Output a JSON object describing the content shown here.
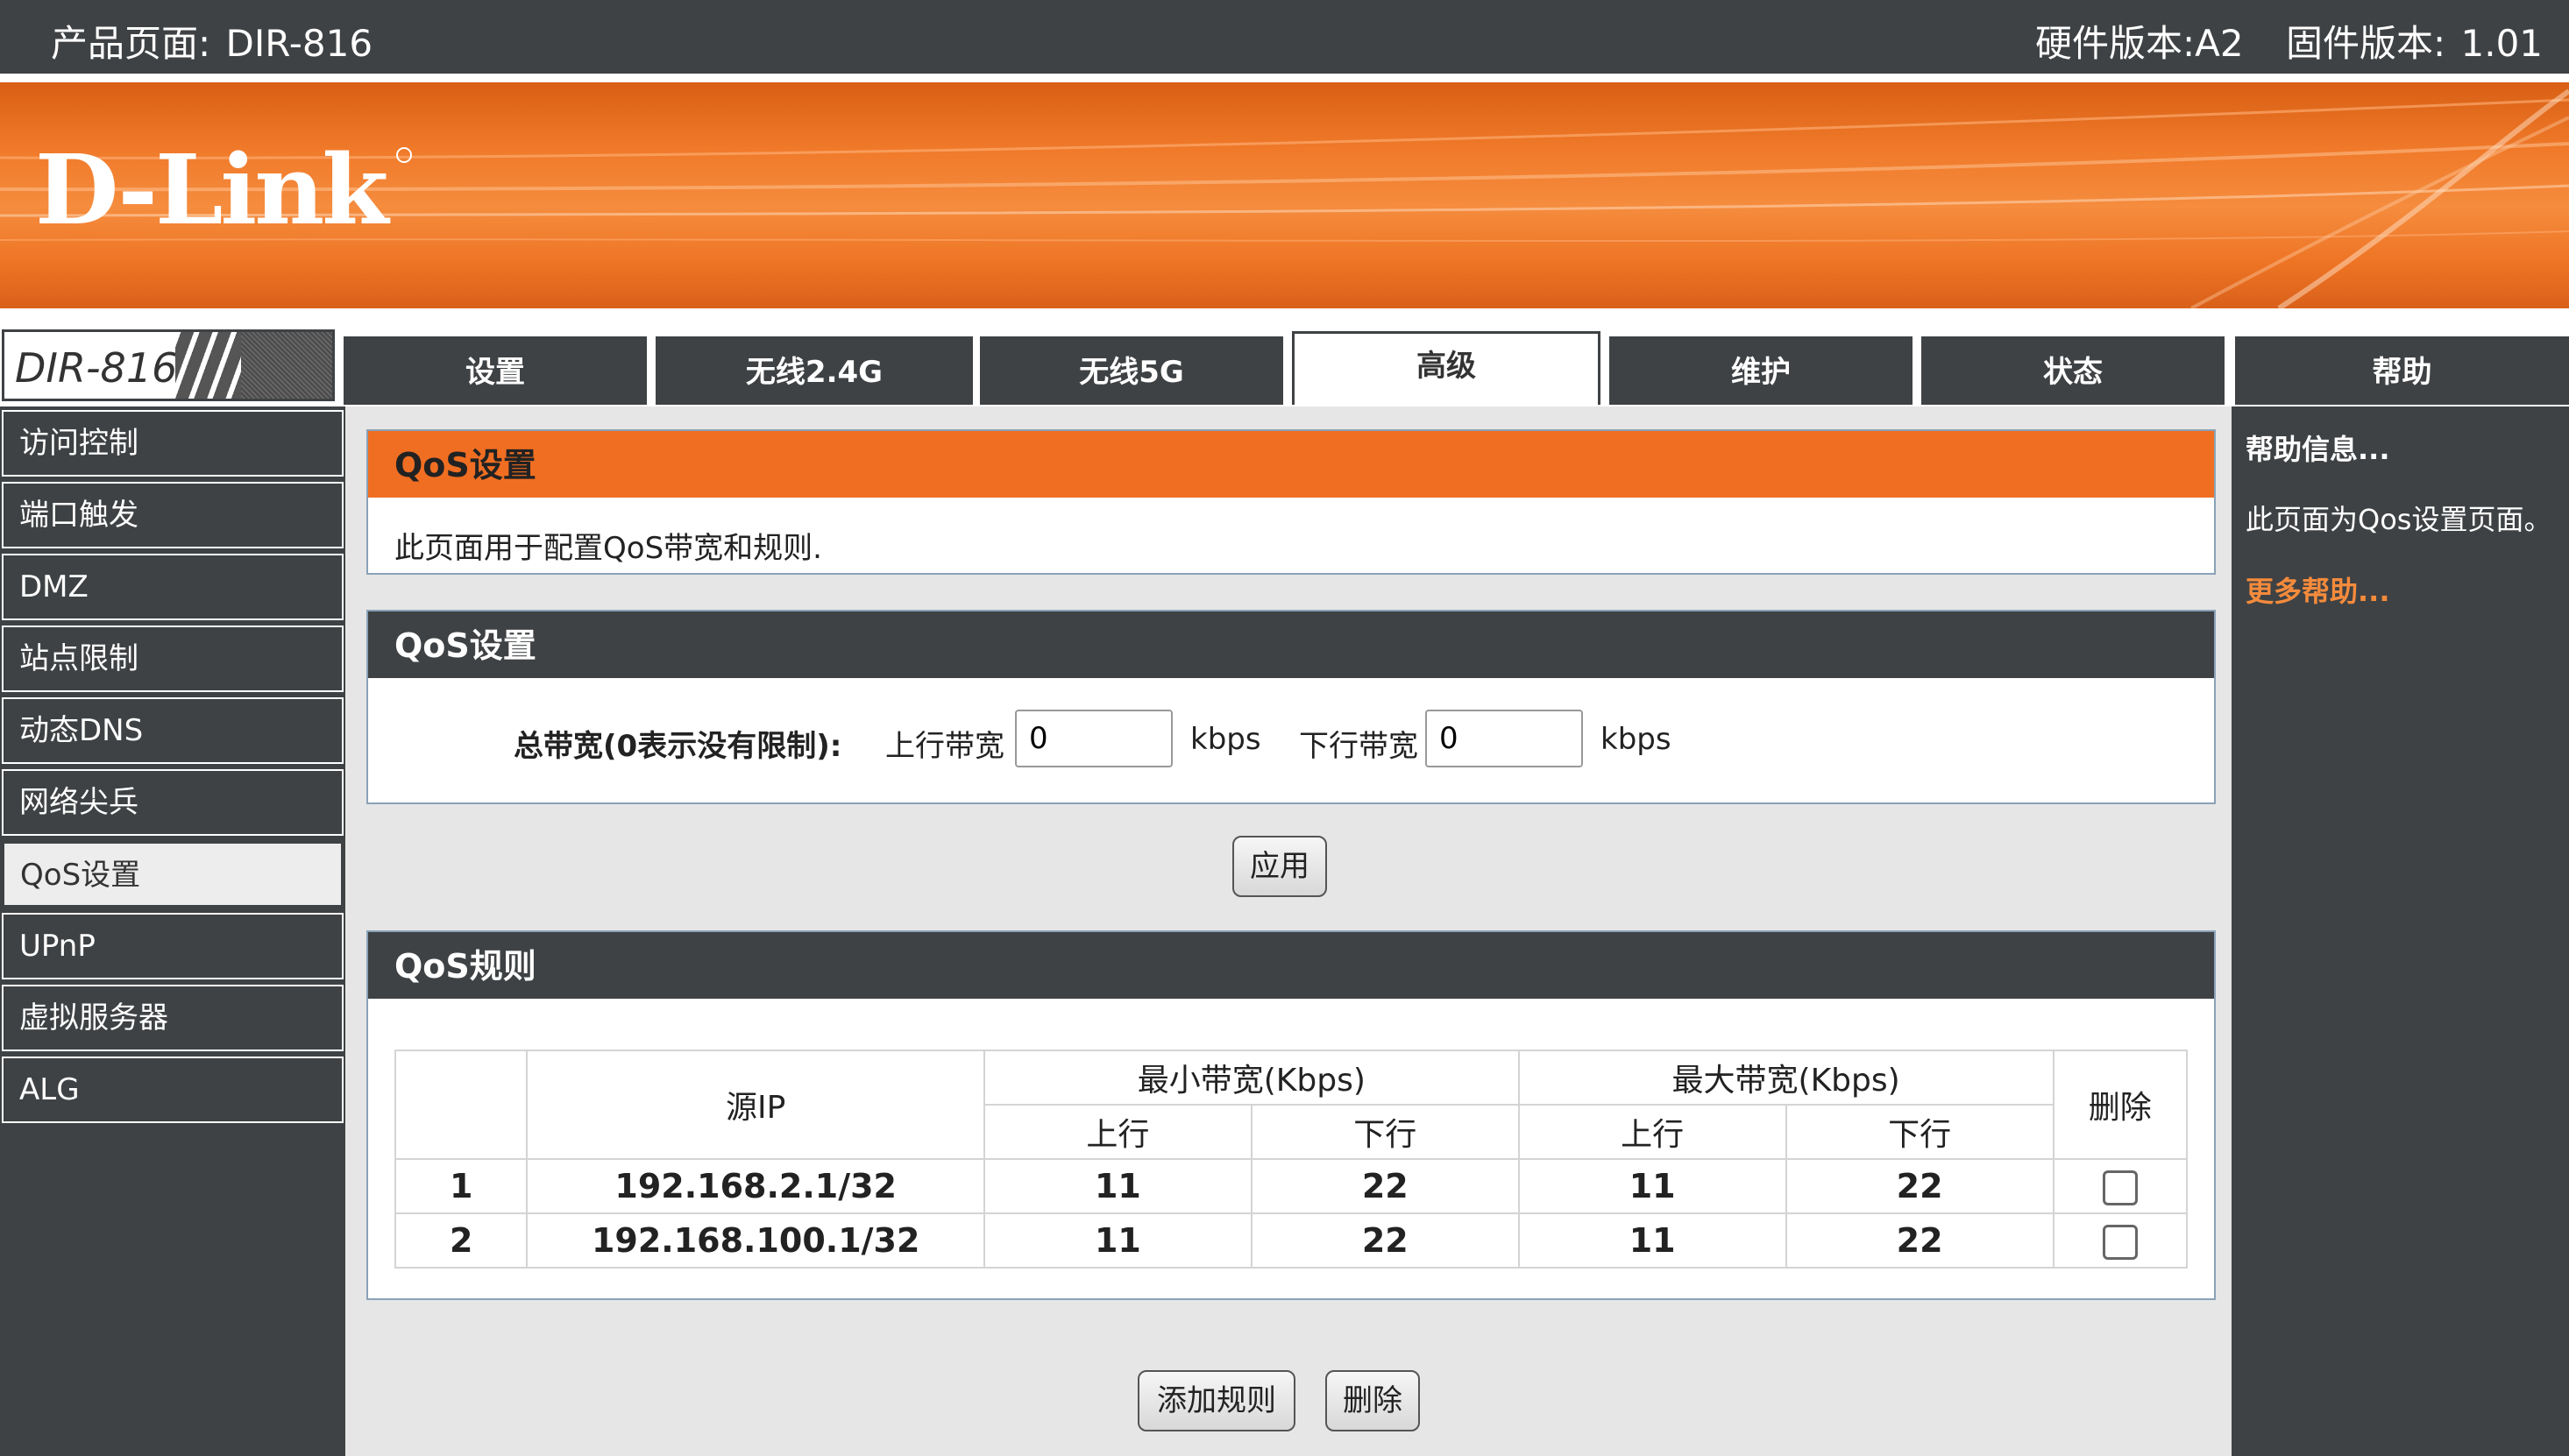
{
  "header": {
    "product_label": "产品页面:",
    "product_value": "DIR-816",
    "hardware_label": "硬件版本:",
    "hardware_value": "A2",
    "firmware_label": "固件版本:",
    "firmware_value": "1.01"
  },
  "brand": {
    "logo_text": "D-Link",
    "model_badge": "DIR-816"
  },
  "tabs": [
    {
      "label": "设置"
    },
    {
      "label": "无线2.4G"
    },
    {
      "label": "无线5G"
    },
    {
      "label": "高级",
      "active": true
    },
    {
      "label": "维护"
    },
    {
      "label": "状态"
    },
    {
      "label": "帮助"
    }
  ],
  "sidebar": {
    "items": [
      {
        "label": "访问控制"
      },
      {
        "label": "端口触发"
      },
      {
        "label": "DMZ"
      },
      {
        "label": "站点限制"
      },
      {
        "label": "动态DNS"
      },
      {
        "label": "网络尖兵"
      },
      {
        "label": "QoS设置",
        "active": true
      },
      {
        "label": "UPnP"
      },
      {
        "label": "虚拟服务器"
      },
      {
        "label": "ALG"
      }
    ]
  },
  "intro_panel": {
    "title": "QoS设置",
    "description": "此页面用于配置QoS带宽和规则."
  },
  "bandwidth_panel": {
    "title": "QoS设置",
    "total_label": "总带宽(0表示没有限制):",
    "up_label": "上行带宽",
    "up_value": "0",
    "up_unit": "kbps",
    "down_label": "下行带宽",
    "down_value": "0",
    "down_unit": "kbps"
  },
  "apply_button": "应用",
  "rules_panel": {
    "title": "QoS规则",
    "headers": {
      "source_ip": "源IP",
      "min_bw": "最小带宽(Kbps)",
      "max_bw": "最大带宽(Kbps)",
      "up": "上行",
      "down": "下行",
      "delete": "删除"
    },
    "rows": [
      {
        "index": "1",
        "ip": "192.168.2.1/32",
        "min_up": "11",
        "min_down": "22",
        "max_up": "11",
        "max_down": "22",
        "checked": false
      },
      {
        "index": "2",
        "ip": "192.168.100.1/32",
        "min_up": "11",
        "min_down": "22",
        "max_up": "11",
        "max_down": "22",
        "checked": false
      }
    ]
  },
  "actions": {
    "add_rule": "添加规则",
    "delete": "删除"
  },
  "help": {
    "title": "帮助信息...",
    "body": "此页面为Qos设置页面。",
    "more": "更多帮助..."
  },
  "colors": {
    "accent_orange": "#f06e22",
    "dark_gray": "#3f4244",
    "link_orange": "#f58b3c"
  }
}
